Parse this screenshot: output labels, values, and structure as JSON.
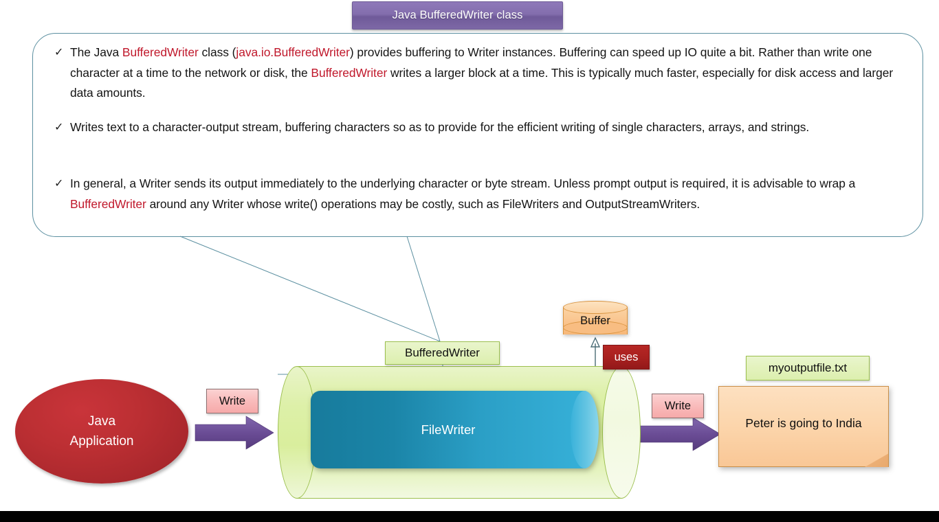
{
  "title": {
    "text": "Java BufferedWriter class",
    "bg": "#7d68a6"
  },
  "callout": {
    "border_color": "#5b8fa0",
    "highlight_color": "#c0182b",
    "bullets": [
      {
        "marker": "✓",
        "segments": [
          {
            "t": "The Java ",
            "hl": false
          },
          {
            "t": "BufferedWriter",
            "hl": true
          },
          {
            "t": " class (",
            "hl": false
          },
          {
            "t": "java.io.BufferedWriter",
            "hl": true
          },
          {
            "t": ") provides buffering to Writer instances. Buffering can speed up IO quite a bit. Rather than write one character at a time to the network or disk, the ",
            "hl": false
          },
          {
            "t": "BufferedWriter",
            "hl": true
          },
          {
            "t": " writes a larger block at a time. This is typically much faster, especially for disk access and larger data amounts.",
            "hl": false
          }
        ]
      },
      {
        "marker": "✓",
        "segments": [
          {
            "t": "Writes text to a character-output stream, buffering characters so as to provide for the efficient writing of single characters, arrays, and strings.",
            "hl": false
          }
        ]
      },
      {
        "marker": "✓",
        "segments": [
          {
            "t": "In general, a Writer sends its output immediately to the underlying character or byte stream. Unless prompt output is required, it is advisable to wrap a ",
            "hl": false
          },
          {
            "t": "BufferedWriter",
            "hl": true
          },
          {
            "t": " around any Writer whose write() operations may be costly, such as FileWriters and OutputStreamWriters.",
            "hl": false
          }
        ]
      }
    ]
  },
  "diagram": {
    "java_app": {
      "line1": "Java",
      "line2": "Application",
      "color": "#bc2f33"
    },
    "write_in": {
      "label": "Write",
      "color": "#f9bcbc"
    },
    "write_out": {
      "label": "Write",
      "color": "#f9bcbc"
    },
    "buffered_writer": {
      "label": "BufferedWriter",
      "color": "#e3f2bd"
    },
    "file_writer": {
      "label": "FileWriter",
      "color": "#2b9fc6"
    },
    "buffer": {
      "label": "Buffer",
      "color": "#fac48d"
    },
    "uses": {
      "label": "uses",
      "color": "#a9211f"
    },
    "outfile": {
      "label": "myoutputfile.txt",
      "color": "#e3f2bd"
    },
    "document": {
      "text": "Peter is going to India",
      "color": "#fcd6ad"
    },
    "arrow_color": "#6b4d96",
    "connector_color": "#5b8fa0"
  }
}
